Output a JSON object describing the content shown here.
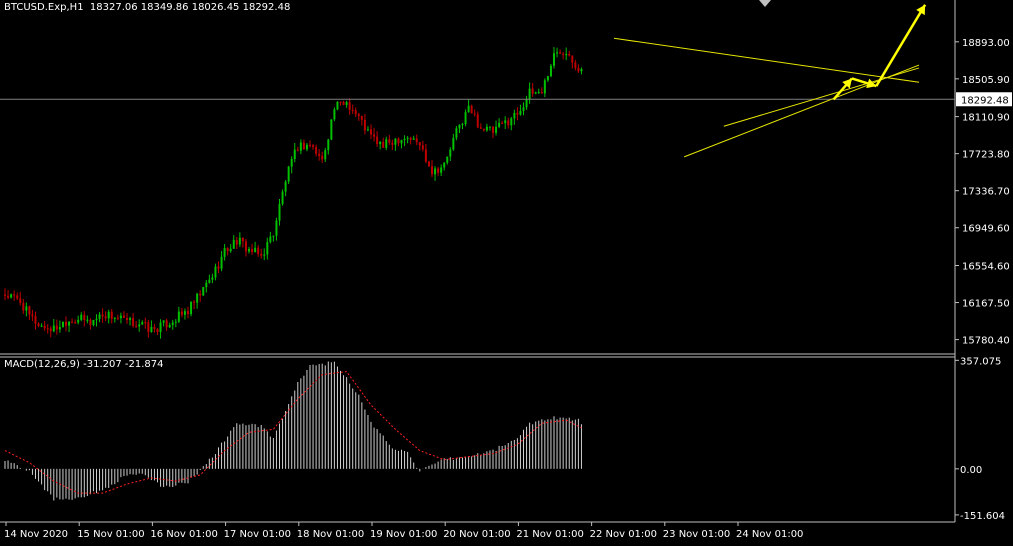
{
  "header": {
    "symbol_info": "BTCUSD.Exp,H1  18327.06 18349.86 18026.45 18292.48"
  },
  "indicator": {
    "label": "MACD(12,26,9) -31.207 -21.874"
  },
  "colors": {
    "background": "#000000",
    "bull_candle": "#00c000",
    "bear_candle": "#c00000",
    "axis": "#c0c0c0",
    "text": "#ffffff",
    "trendline": "#e6e600",
    "arrow": "#ffff00",
    "signal": "#ff2020",
    "macd_hist": "#d0d0d0",
    "price_line": "#808080"
  },
  "chart_data": [
    {
      "type": "candlestick",
      "symbol": "BTCUSD.Exp",
      "timeframe": "H1",
      "current_price": 18292.48,
      "ylim": [
        15640,
        19330
      ],
      "y_ticks": [
        "18893.00",
        "18505.90",
        "18110.90",
        "17723.80",
        "17336.70",
        "16949.60",
        "16554.60",
        "16167.50",
        "15780.40"
      ],
      "x_ticks": [
        "14 Nov 2020",
        "15 Nov 01:00",
        "16 Nov 01:00",
        "17 Nov 01:00",
        "18 Nov 01:00",
        "19 Nov 01:00",
        "20 Nov 01:00",
        "21 Nov 01:00",
        "22 Nov 01:00",
        "23 Nov 01:00",
        "24 Nov 01:00"
      ],
      "bars_visible": 190,
      "close_path": [
        [
          0,
          16250
        ],
        [
          5,
          16180
        ],
        [
          8,
          16020
        ],
        [
          12,
          15920
        ],
        [
          16,
          15890
        ],
        [
          20,
          15980
        ],
        [
          24,
          16000
        ],
        [
          28,
          15960
        ],
        [
          32,
          16050
        ],
        [
          36,
          16020
        ],
        [
          40,
          15960
        ],
        [
          44,
          15950
        ],
        [
          48,
          15880
        ],
        [
          52,
          15930
        ],
        [
          56,
          16000
        ],
        [
          60,
          16080
        ],
        [
          64,
          16250
        ],
        [
          68,
          16450
        ],
        [
          72,
          16700
        ],
        [
          76,
          16820
        ],
        [
          80,
          16720
        ],
        [
          84,
          16650
        ],
        [
          88,
          16900
        ],
        [
          92,
          17450
        ],
        [
          96,
          17800
        ],
        [
          100,
          17820
        ],
        [
          104,
          17650
        ],
        [
          108,
          18200
        ],
        [
          112,
          18270
        ],
        [
          116,
          18100
        ],
        [
          120,
          17900
        ],
        [
          124,
          17800
        ],
        [
          128,
          17880
        ],
        [
          132,
          17900
        ],
        [
          136,
          17820
        ],
        [
          140,
          17550
        ],
        [
          144,
          17600
        ],
        [
          148,
          17950
        ],
        [
          152,
          18200
        ],
        [
          156,
          18000
        ],
        [
          160,
          17950
        ],
        [
          164,
          18050
        ],
        [
          168,
          18150
        ],
        [
          172,
          18350
        ],
        [
          176,
          18380
        ],
        [
          180,
          18750
        ],
        [
          184,
          18820
        ],
        [
          188,
          18620
        ],
        [
          192,
          18700
        ],
        [
          196,
          18850
        ],
        [
          200,
          18900
        ],
        [
          204,
          18760
        ],
        [
          208,
          18760
        ],
        [
          212,
          18720
        ],
        [
          216,
          18600
        ],
        [
          220,
          18450
        ],
        [
          224,
          18000
        ],
        [
          228,
          18100
        ],
        [
          232,
          18500
        ],
        [
          236,
          18700
        ],
        [
          240,
          18300
        ],
        [
          244,
          18500
        ],
        [
          248,
          18600
        ],
        [
          252,
          18620
        ],
        [
          256,
          18450
        ],
        [
          260,
          18350
        ],
        [
          264,
          18420
        ],
        [
          268,
          18380
        ],
        [
          272,
          18292
        ]
      ],
      "trendlines": [
        {
          "name": "upper-resistance",
          "points": [
            [
              200,
              18930
            ],
            [
              300,
              18470
            ]
          ]
        },
        {
          "name": "lower-support",
          "points": [
            [
              223,
              17690
            ],
            [
              300,
              18650
            ]
          ]
        },
        {
          "name": "inner-support",
          "points": [
            [
              236,
              18010
            ],
            [
              300,
              18620
            ]
          ]
        },
        {
          "name": "horizontal-price",
          "points": [
            [
              0,
              18292
            ],
            [
              300,
              18292
            ]
          ]
        }
      ],
      "arrows": [
        {
          "from": [
            272,
            18290
          ],
          "to": [
            278,
            18510
          ]
        },
        {
          "from": [
            278,
            18510
          ],
          "to": [
            286,
            18430
          ]
        },
        {
          "from": [
            286,
            18430
          ],
          "to": [
            302,
            19280
          ]
        }
      ]
    },
    {
      "type": "bar",
      "name": "MACD(12,26,9)",
      "main_value": -31.207,
      "signal_value": -21.874,
      "ylim": [
        -175,
        368
      ],
      "y_ticks": [
        "357.075",
        "0.00",
        "-151.604"
      ],
      "macd_path": [
        [
          0,
          30
        ],
        [
          8,
          -5
        ],
        [
          16,
          -100
        ],
        [
          24,
          -95
        ],
        [
          32,
          -70
        ],
        [
          40,
          -20
        ],
        [
          44,
          -15
        ],
        [
          52,
          -60
        ],
        [
          60,
          -45
        ],
        [
          68,
          40
        ],
        [
          76,
          150
        ],
        [
          84,
          140
        ],
        [
          88,
          100
        ],
        [
          96,
          280
        ],
        [
          100,
          340
        ],
        [
          108,
          350
        ],
        [
          112,
          300
        ],
        [
          116,
          240
        ],
        [
          120,
          150
        ],
        [
          128,
          60
        ],
        [
          132,
          60
        ],
        [
          136,
          -10
        ],
        [
          144,
          30
        ],
        [
          152,
          40
        ],
        [
          160,
          60
        ],
        [
          168,
          100
        ],
        [
          172,
          150
        ],
        [
          180,
          170
        ],
        [
          188,
          160
        ],
        [
          196,
          100
        ],
        [
          200,
          60
        ],
        [
          208,
          50
        ],
        [
          216,
          -20
        ],
        [
          220,
          -100
        ],
        [
          224,
          -160
        ],
        [
          228,
          -100
        ],
        [
          232,
          -30
        ],
        [
          240,
          -20
        ],
        [
          248,
          60
        ],
        [
          252,
          20
        ],
        [
          256,
          -20
        ],
        [
          264,
          -20
        ],
        [
          272,
          -31
        ]
      ],
      "signal_path": [
        [
          0,
          60
        ],
        [
          8,
          20
        ],
        [
          16,
          -40
        ],
        [
          24,
          -80
        ],
        [
          32,
          -80
        ],
        [
          40,
          -50
        ],
        [
          48,
          -30
        ],
        [
          56,
          -40
        ],
        [
          64,
          -20
        ],
        [
          72,
          60
        ],
        [
          80,
          120
        ],
        [
          88,
          130
        ],
        [
          96,
          230
        ],
        [
          104,
          310
        ],
        [
          112,
          320
        ],
        [
          120,
          210
        ],
        [
          128,
          130
        ],
        [
          136,
          60
        ],
        [
          144,
          30
        ],
        [
          152,
          40
        ],
        [
          160,
          50
        ],
        [
          168,
          80
        ],
        [
          176,
          150
        ],
        [
          184,
          160
        ],
        [
          192,
          120
        ],
        [
          200,
          90
        ],
        [
          208,
          60
        ],
        [
          216,
          10
        ],
        [
          224,
          -60
        ],
        [
          232,
          -80
        ],
        [
          240,
          -30
        ],
        [
          248,
          10
        ],
        [
          256,
          10
        ],
        [
          264,
          -10
        ],
        [
          272,
          -22
        ]
      ]
    }
  ]
}
